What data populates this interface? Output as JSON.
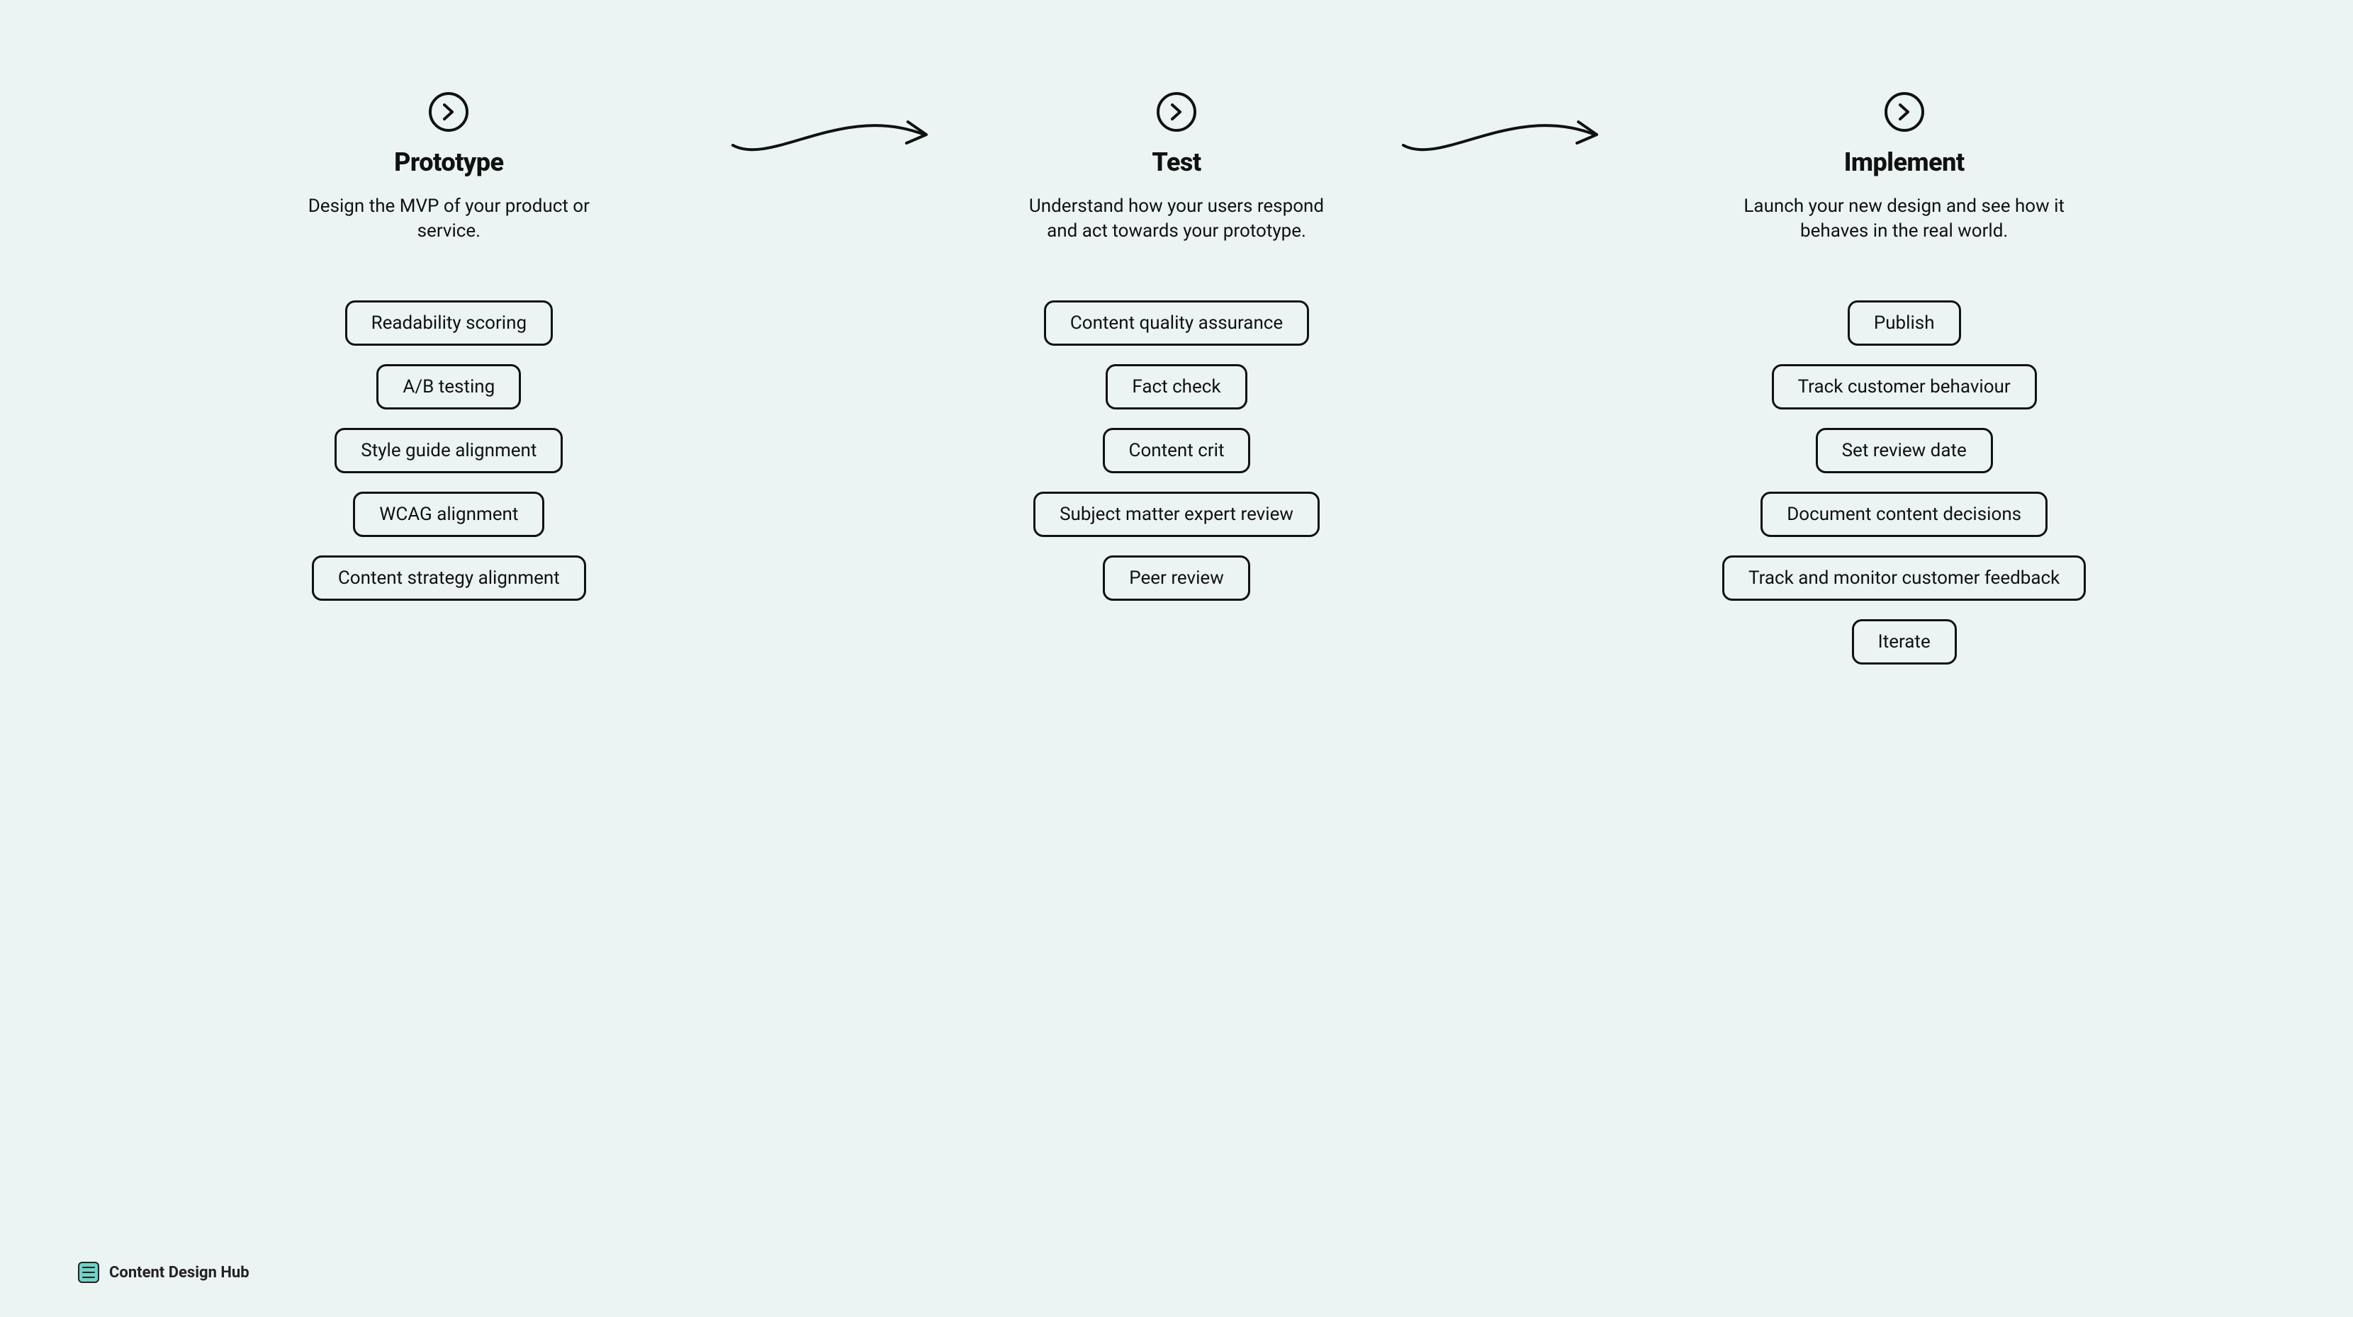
{
  "brand": "Content Design Hub",
  "columns": [
    {
      "title": "Prototype",
      "description": "Design the MVP of your product or service.",
      "items": [
        "Readability scoring",
        "A/B testing",
        "Style guide alignment",
        "WCAG alignment",
        "Content strategy alignment"
      ]
    },
    {
      "title": "Test",
      "description": "Understand how your users respond and act towards your prototype.",
      "items": [
        "Content quality assurance",
        "Fact check",
        "Content crit",
        "Subject matter expert review",
        "Peer review"
      ]
    },
    {
      "title": "Implement",
      "description": "Launch your new design and see how it behaves in the real world.",
      "items": [
        "Publish",
        "Track customer behaviour",
        "Set review date",
        "Document content decisions",
        "Track and monitor customer feedback",
        "Iterate"
      ]
    }
  ]
}
